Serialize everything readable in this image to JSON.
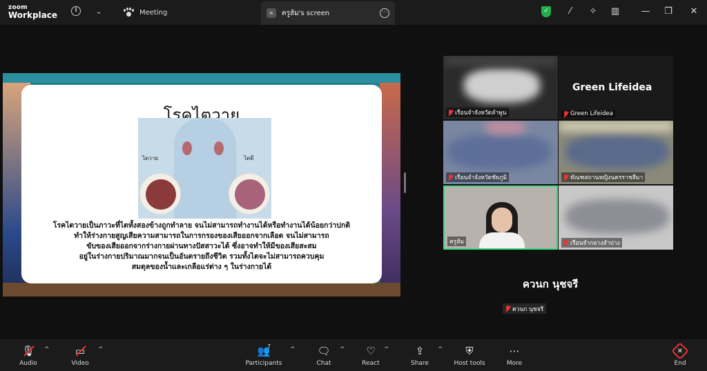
{
  "titlebar": {
    "logo_line1": "zoom",
    "logo_line2": "Workplace",
    "meeting_tab": "Meeting",
    "screen_tab": "ครูส้ม's screen",
    "screen_tab_avatar": "ค"
  },
  "slide": {
    "title": "โรคไตวาย",
    "label_left": "ไตวาย",
    "label_right": "ไตดี",
    "lines": [
      "โรคไตวายเป็นภาวะที่ไตทั้งสองข้างถูกทำลาย จนไม่สามารถทำงานได้หรือทำงานได้น้อยกว่าปกติ",
      "ทำให้ร่างกายสูญเสียความสามารถในการกรองของเสียออกจากเลือด จนไม่สามารถ",
      "ขับของเสียออกจากร่างกายผ่านทางปัสสาวะได้ ซึ่งอาจทำให้มีของเสียสะสม",
      "อยู่ในร่างกายปริมาณมากจนเป็นอันตรายถึงชีวิต รวมทั้งไตจะไม่สามารถควบคุม",
      "สมดุลของน้ำและเกลือแร่ต่าง ๆ ในร่างกายได้"
    ]
  },
  "gallery": {
    "tiles": [
      {
        "label": "เรือนจำจังหวัดลำพูน"
      },
      {
        "label": "Green Lifeidea",
        "big_name": "Green Lifeidea"
      },
      {
        "label": "เรือนจำจังหวัดชัยภูมิ"
      },
      {
        "label": "ทัณฑสถานหญิงนครราชสีมา"
      },
      {
        "label": "ครูส้ม"
      },
      {
        "label": "เรือนจำกลางลำปาง"
      }
    ],
    "solo_big_name": "ควนก นุชจรี",
    "solo_chip": "ควนก นุชจรี"
  },
  "toolbar": {
    "audio": "Audio",
    "video": "Video",
    "participants": "Participants",
    "participants_count": "7",
    "chat": "Chat",
    "react": "React",
    "share": "Share",
    "host_tools": "Host tools",
    "more": "More",
    "end": "End"
  },
  "colors": {
    "accent_green": "#22b04b",
    "end_red": "#e33333",
    "active_speaker": "#3ddc84"
  }
}
